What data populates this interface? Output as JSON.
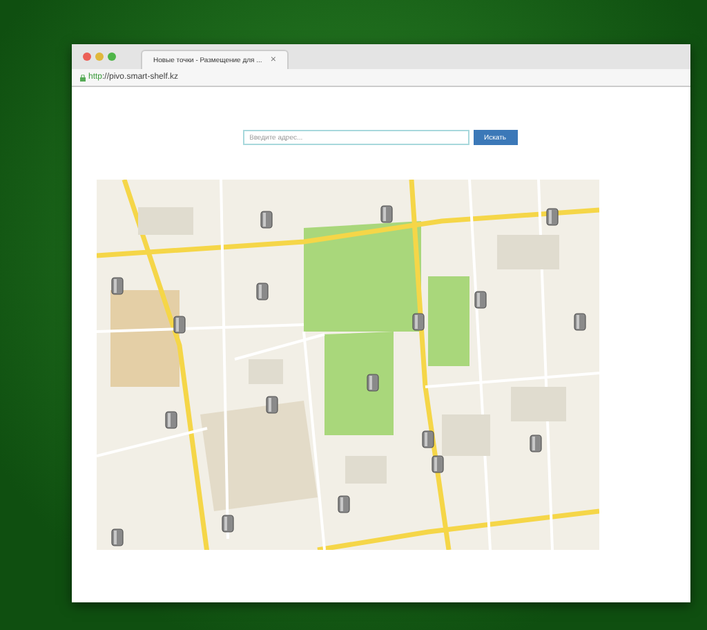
{
  "browser": {
    "tab_title": "Новые точки - Размещение для ...",
    "tab_close": "×",
    "url_scheme": "http",
    "url_rest": "://pivo.smart-shelf.kz"
  },
  "search": {
    "placeholder": "Введите адрес...",
    "button": "Искать"
  }
}
